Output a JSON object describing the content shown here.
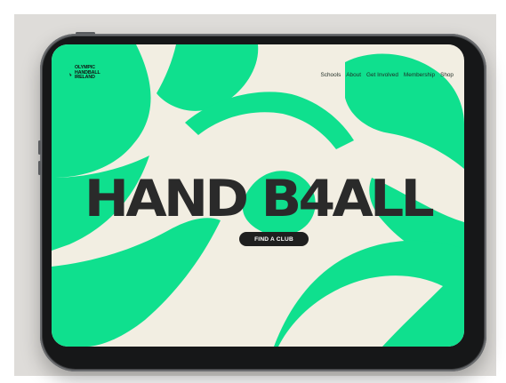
{
  "brand": {
    "name_lines": [
      "OLYMPIC",
      "HANDBALL",
      "IRELAND"
    ],
    "logo_icon": "handball-player-icon",
    "accent": "#0fe08e",
    "background": "#f2eee2",
    "text": "#1e2b24"
  },
  "nav": {
    "items": [
      "Schools",
      "About",
      "Get Involved",
      "Membership",
      "Shop"
    ]
  },
  "hero": {
    "title": "HAND B4ALL",
    "cta_label": "FIND A CLUB"
  }
}
